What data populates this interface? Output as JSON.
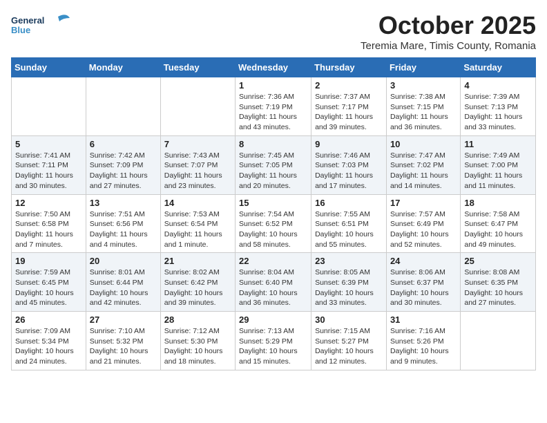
{
  "header": {
    "logo_general": "General",
    "logo_blue": "Blue",
    "month": "October 2025",
    "location": "Teremia Mare, Timis County, Romania"
  },
  "weekdays": [
    "Sunday",
    "Monday",
    "Tuesday",
    "Wednesday",
    "Thursday",
    "Friday",
    "Saturday"
  ],
  "weeks": [
    [
      {
        "day": "",
        "info": ""
      },
      {
        "day": "",
        "info": ""
      },
      {
        "day": "",
        "info": ""
      },
      {
        "day": "1",
        "info": "Sunrise: 7:36 AM\nSunset: 7:19 PM\nDaylight: 11 hours\nand 43 minutes."
      },
      {
        "day": "2",
        "info": "Sunrise: 7:37 AM\nSunset: 7:17 PM\nDaylight: 11 hours\nand 39 minutes."
      },
      {
        "day": "3",
        "info": "Sunrise: 7:38 AM\nSunset: 7:15 PM\nDaylight: 11 hours\nand 36 minutes."
      },
      {
        "day": "4",
        "info": "Sunrise: 7:39 AM\nSunset: 7:13 PM\nDaylight: 11 hours\nand 33 minutes."
      }
    ],
    [
      {
        "day": "5",
        "info": "Sunrise: 7:41 AM\nSunset: 7:11 PM\nDaylight: 11 hours\nand 30 minutes."
      },
      {
        "day": "6",
        "info": "Sunrise: 7:42 AM\nSunset: 7:09 PM\nDaylight: 11 hours\nand 27 minutes."
      },
      {
        "day": "7",
        "info": "Sunrise: 7:43 AM\nSunset: 7:07 PM\nDaylight: 11 hours\nand 23 minutes."
      },
      {
        "day": "8",
        "info": "Sunrise: 7:45 AM\nSunset: 7:05 PM\nDaylight: 11 hours\nand 20 minutes."
      },
      {
        "day": "9",
        "info": "Sunrise: 7:46 AM\nSunset: 7:03 PM\nDaylight: 11 hours\nand 17 minutes."
      },
      {
        "day": "10",
        "info": "Sunrise: 7:47 AM\nSunset: 7:02 PM\nDaylight: 11 hours\nand 14 minutes."
      },
      {
        "day": "11",
        "info": "Sunrise: 7:49 AM\nSunset: 7:00 PM\nDaylight: 11 hours\nand 11 minutes."
      }
    ],
    [
      {
        "day": "12",
        "info": "Sunrise: 7:50 AM\nSunset: 6:58 PM\nDaylight: 11 hours\nand 7 minutes."
      },
      {
        "day": "13",
        "info": "Sunrise: 7:51 AM\nSunset: 6:56 PM\nDaylight: 11 hours\nand 4 minutes."
      },
      {
        "day": "14",
        "info": "Sunrise: 7:53 AM\nSunset: 6:54 PM\nDaylight: 11 hours\nand 1 minute."
      },
      {
        "day": "15",
        "info": "Sunrise: 7:54 AM\nSunset: 6:52 PM\nDaylight: 10 hours\nand 58 minutes."
      },
      {
        "day": "16",
        "info": "Sunrise: 7:55 AM\nSunset: 6:51 PM\nDaylight: 10 hours\nand 55 minutes."
      },
      {
        "day": "17",
        "info": "Sunrise: 7:57 AM\nSunset: 6:49 PM\nDaylight: 10 hours\nand 52 minutes."
      },
      {
        "day": "18",
        "info": "Sunrise: 7:58 AM\nSunset: 6:47 PM\nDaylight: 10 hours\nand 49 minutes."
      }
    ],
    [
      {
        "day": "19",
        "info": "Sunrise: 7:59 AM\nSunset: 6:45 PM\nDaylight: 10 hours\nand 45 minutes."
      },
      {
        "day": "20",
        "info": "Sunrise: 8:01 AM\nSunset: 6:44 PM\nDaylight: 10 hours\nand 42 minutes."
      },
      {
        "day": "21",
        "info": "Sunrise: 8:02 AM\nSunset: 6:42 PM\nDaylight: 10 hours\nand 39 minutes."
      },
      {
        "day": "22",
        "info": "Sunrise: 8:04 AM\nSunset: 6:40 PM\nDaylight: 10 hours\nand 36 minutes."
      },
      {
        "day": "23",
        "info": "Sunrise: 8:05 AM\nSunset: 6:39 PM\nDaylight: 10 hours\nand 33 minutes."
      },
      {
        "day": "24",
        "info": "Sunrise: 8:06 AM\nSunset: 6:37 PM\nDaylight: 10 hours\nand 30 minutes."
      },
      {
        "day": "25",
        "info": "Sunrise: 8:08 AM\nSunset: 6:35 PM\nDaylight: 10 hours\nand 27 minutes."
      }
    ],
    [
      {
        "day": "26",
        "info": "Sunrise: 7:09 AM\nSunset: 5:34 PM\nDaylight: 10 hours\nand 24 minutes."
      },
      {
        "day": "27",
        "info": "Sunrise: 7:10 AM\nSunset: 5:32 PM\nDaylight: 10 hours\nand 21 minutes."
      },
      {
        "day": "28",
        "info": "Sunrise: 7:12 AM\nSunset: 5:30 PM\nDaylight: 10 hours\nand 18 minutes."
      },
      {
        "day": "29",
        "info": "Sunrise: 7:13 AM\nSunset: 5:29 PM\nDaylight: 10 hours\nand 15 minutes."
      },
      {
        "day": "30",
        "info": "Sunrise: 7:15 AM\nSunset: 5:27 PM\nDaylight: 10 hours\nand 12 minutes."
      },
      {
        "day": "31",
        "info": "Sunrise: 7:16 AM\nSunset: 5:26 PM\nDaylight: 10 hours\nand 9 minutes."
      },
      {
        "day": "",
        "info": ""
      }
    ]
  ]
}
